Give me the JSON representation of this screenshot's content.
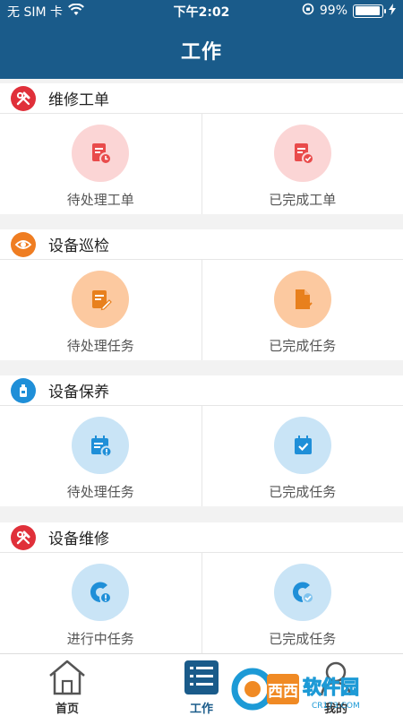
{
  "status_bar": {
    "carrier": "无 SIM 卡",
    "time": "下午2:02",
    "battery": "99%",
    "battery_level": 0.99
  },
  "header": {
    "title": "工作"
  },
  "sections": [
    {
      "title": "维修工单",
      "icon": "wrench-hammer-icon",
      "color": "#e0303a",
      "items": [
        {
          "label": "待处理工单",
          "icon": "pending-document-icon",
          "circle": "#fbd5d5",
          "fg": "#e94b4b"
        },
        {
          "label": "已完成工单",
          "icon": "completed-document-icon",
          "circle": "#fbd5d5",
          "fg": "#e94b4b"
        }
      ]
    },
    {
      "title": "设备巡检",
      "icon": "inspection-eye-icon",
      "color": "#ef7d22",
      "items": [
        {
          "label": "待处理任务",
          "icon": "pending-edit-icon",
          "circle": "#fcc9a0",
          "fg": "#e8801d"
        },
        {
          "label": "已完成任务",
          "icon": "completed-file-icon",
          "circle": "#fcc9a0",
          "fg": "#e8801d"
        }
      ]
    },
    {
      "title": "设备保养",
      "icon": "maintenance-bottle-icon",
      "color": "#1f8fd8",
      "items": [
        {
          "label": "待处理任务",
          "icon": "pending-calendar-icon",
          "circle": "#c9e4f6",
          "fg": "#1f8fd8"
        },
        {
          "label": "已完成任务",
          "icon": "completed-calendar-icon",
          "circle": "#c9e4f6",
          "fg": "#1f8fd8"
        }
      ]
    },
    {
      "title": "设备维修",
      "icon": "wrench-hammer-icon",
      "color": "#e0303a",
      "items": [
        {
          "label": "进行中任务",
          "icon": "in-progress-repair-icon",
          "circle": "#c9e4f6",
          "fg": "#1f8fd8"
        },
        {
          "label": "已完成任务",
          "icon": "completed-repair-icon",
          "circle": "#c9e4f6",
          "fg": "#1f8fd8"
        }
      ]
    }
  ],
  "tabbar": {
    "home": "首页",
    "work": "工作",
    "mine": "我的",
    "active": "work"
  },
  "watermark": {
    "text": "西西软件园",
    "sub": "CR173.COM"
  }
}
